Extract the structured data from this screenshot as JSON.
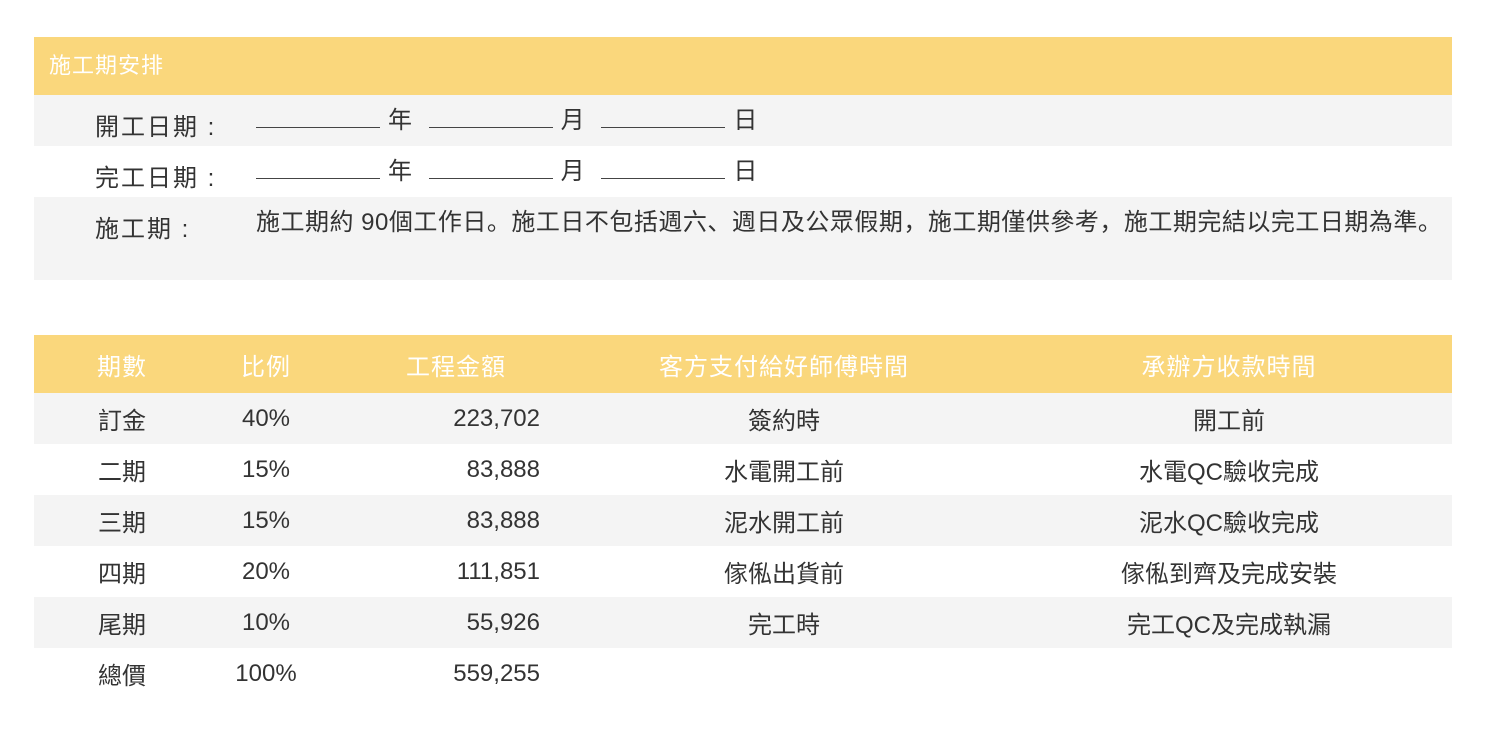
{
  "schedule": {
    "section_title": "施工期安排",
    "start_label": "開工日期 :",
    "end_label": "完工日期 :",
    "period_label": "施工期 :",
    "year_unit": "年",
    "month_unit": "月",
    "day_unit": "日",
    "period_text": "施工期約 90個工作日。施工日不包括週六、週日及公眾假期，施工期僅供參考，施工期完結以完工日期為準。"
  },
  "payment": {
    "headers": [
      "期數",
      "比例",
      "工程金額",
      "客方支付給好師傅時間",
      "承辦方收款時間"
    ],
    "rows": [
      {
        "stage": "訂金",
        "ratio": "40%",
        "amount": "223,702",
        "client_pay": "簽約時",
        "receipt": "開工前"
      },
      {
        "stage": "二期",
        "ratio": "15%",
        "amount": "83,888",
        "client_pay": "水電開工前",
        "receipt": "水電QC驗收完成"
      },
      {
        "stage": "三期",
        "ratio": "15%",
        "amount": "83,888",
        "client_pay": "泥水開工前",
        "receipt": "泥水QC驗收完成"
      },
      {
        "stage": "四期",
        "ratio": "20%",
        "amount": "111,851",
        "client_pay": "傢俬出貨前",
        "receipt": "傢俬到齊及完成安裝"
      },
      {
        "stage": "尾期",
        "ratio": "10%",
        "amount": "55,926",
        "client_pay": "完工時",
        "receipt": "完工QC及完成執漏"
      },
      {
        "stage": "總價",
        "ratio": "100%",
        "amount": "559,255",
        "client_pay": "",
        "receipt": ""
      }
    ]
  },
  "colors": {
    "header_bg": "#fad77c",
    "row_alt_bg": "#f4f4f4",
    "text": "#333333"
  }
}
